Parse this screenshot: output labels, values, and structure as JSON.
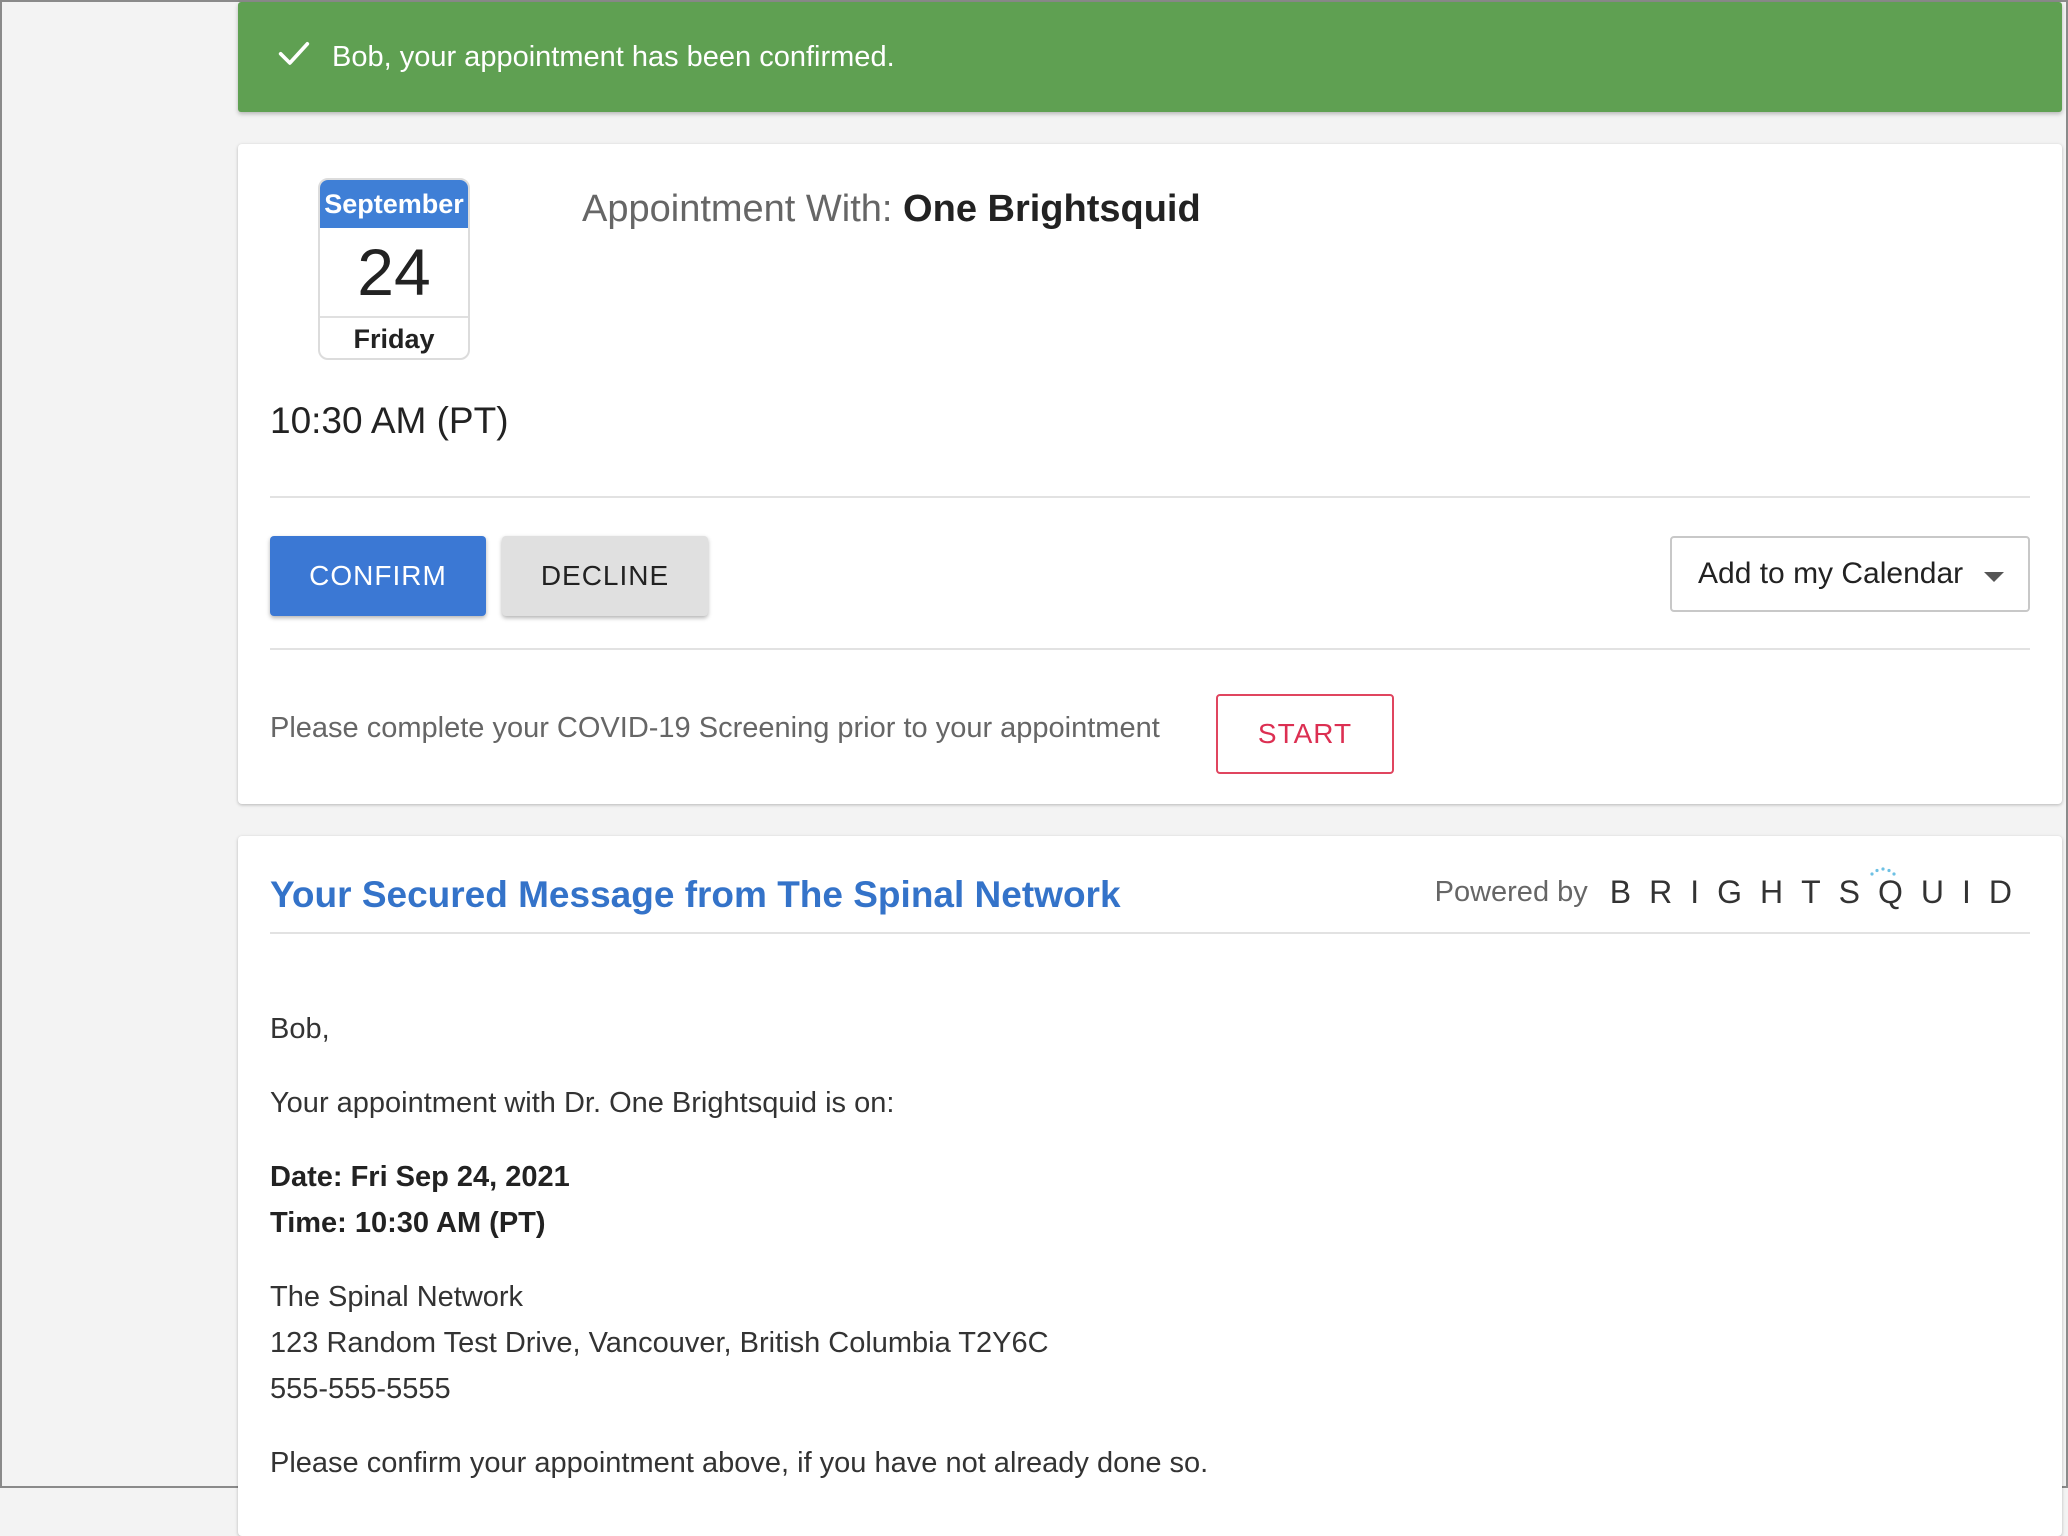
{
  "alert": {
    "text": "Bob, your appointment has been confirmed."
  },
  "appointment": {
    "calendar": {
      "month": "September",
      "day": "24",
      "weekday": "Friday"
    },
    "with_label": "Appointment With:",
    "with_name": "One Brightsquid",
    "time": "10:30 AM (PT)",
    "confirm_label": "CONFIRM",
    "decline_label": "DECLINE",
    "calendar_select": "Add to my Calendar",
    "covid_text": "Please complete your COVID-19 Screening prior to your appointment",
    "start_label": "START"
  },
  "message": {
    "title": "Your Secured Message from The Spinal Network",
    "powered_by": "Powered by",
    "brand": "BRIGHTSQUID",
    "greeting": "Bob,",
    "intro": "Your appointment with Dr. One Brightsquid is on:",
    "date_line": "Date: Fri Sep 24, 2021",
    "time_line": "Time: 10:30 AM (PT)",
    "clinic_name": "The Spinal Network",
    "clinic_address": "123 Random Test Drive, Vancouver, British Columbia T2Y6C",
    "clinic_phone": "555-555-5555",
    "closing": "Please confirm your appointment above, if you have not already done so."
  },
  "colors": {
    "success": "#5fa052",
    "primary": "#3b78d4",
    "danger": "#dc2f52",
    "link": "#3473c9"
  }
}
